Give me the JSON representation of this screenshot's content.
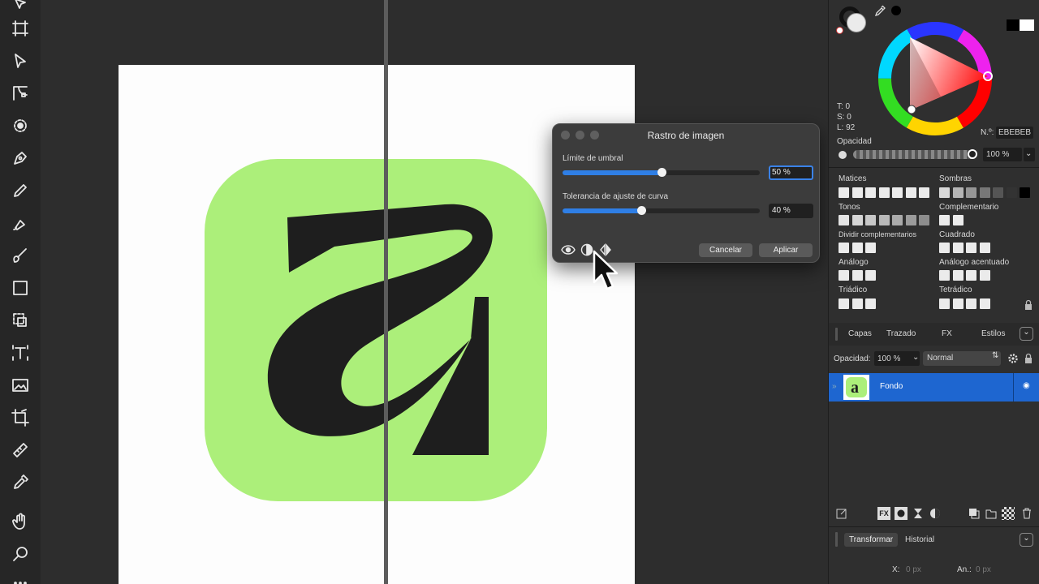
{
  "tools": [
    {
      "name": "move-tool-icon"
    },
    {
      "name": "artboard-tool-icon"
    },
    {
      "name": "node-tool-icon"
    },
    {
      "name": "corner-tool-icon"
    },
    {
      "name": "point-transform-icon"
    },
    {
      "name": "pen-tool-icon"
    },
    {
      "name": "pencil-tool-icon"
    },
    {
      "name": "vector-brush-icon"
    },
    {
      "name": "paint-brush-icon"
    },
    {
      "name": "rectangle-tool-icon"
    },
    {
      "name": "shape-builder-icon"
    },
    {
      "name": "text-tool-icon"
    },
    {
      "name": "image-tool-icon"
    },
    {
      "name": "crop-tool-icon"
    },
    {
      "name": "measure-tool-icon"
    },
    {
      "name": "eyedropper-tool-icon"
    },
    {
      "name": "hand-tool-icon"
    },
    {
      "name": "zoom-tool-icon"
    }
  ],
  "dialog": {
    "title": "Rastro de imagen",
    "threshold_label": "Límite de umbral",
    "threshold_value": "50 %",
    "threshold_fraction": 0.5,
    "curve_label": "Tolerancia de ajuste de curva",
    "curve_value": "40 %",
    "curve_fraction": 0.4,
    "cancel_label": "Cancelar",
    "apply_label": "Aplicar"
  },
  "color": {
    "t": "T: 0",
    "s": "S: 0",
    "l": "L: 92",
    "hex_label": "N.º:",
    "hex_value": "EBEBEB",
    "opacity_label": "Opacidad",
    "opacity_value": "100 %",
    "harmonies": {
      "matices": "Matices",
      "sombras": "Sombras",
      "tonos": "Tonos",
      "complementario": "Complementario",
      "dividir": "Dividir complementarios",
      "cuadrado": "Cuadrado",
      "analogo": "Análogo",
      "analogo_acentuado": "Análogo acentuado",
      "triadico": "Triádico",
      "tetradico": "Tetrádico"
    }
  },
  "layers": {
    "tabs": [
      "Capas",
      "Trazado",
      "FX",
      "Estilos"
    ],
    "opacity_label": "Opacidad:",
    "opacity_value": "100 %",
    "blend_mode": "Normal",
    "layer_name": "Fondo"
  },
  "transform": {
    "tabs": [
      "Transformar",
      "Historial"
    ],
    "x_label": "X:",
    "x_value": "0 px",
    "w_label": "An.:",
    "w_value": "0 px"
  },
  "colors": {
    "accent": "#2f7fe6",
    "logo_green": "#acef7a",
    "logo_dark": "#1e1e1e",
    "layer_selected": "#1e66d0"
  }
}
